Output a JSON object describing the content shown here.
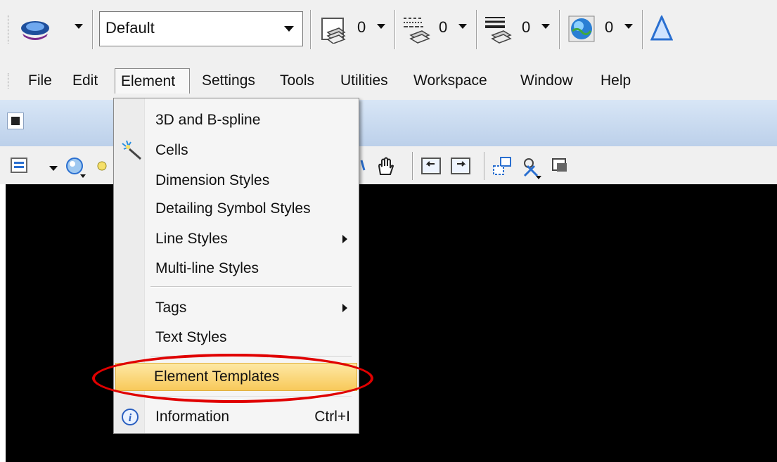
{
  "toolbar": {
    "style_combo_value": "Default",
    "level_count": "0",
    "linestyle_count": "0",
    "weight_count": "0",
    "color_count": "0",
    "icons": [
      "element-attributes-icon",
      "level-display-icon",
      "line-style-icon",
      "line-weight-icon",
      "color-globe-icon",
      "triangle-icon"
    ]
  },
  "menubar": {
    "items": [
      {
        "label": "File",
        "mnemonic": "F"
      },
      {
        "label": "Edit",
        "mnemonic": "E"
      },
      {
        "label": "Element",
        "mnemonic": "l"
      },
      {
        "label": "Settings",
        "mnemonic": "S"
      },
      {
        "label": "Tools",
        "mnemonic": "T"
      },
      {
        "label": "Utilities",
        "mnemonic": "U"
      },
      {
        "label": "Workspace",
        "mnemonic": "k"
      },
      {
        "label": "Window",
        "mnemonic": "W"
      },
      {
        "label": "Help",
        "mnemonic": "H"
      }
    ],
    "active": "Element"
  },
  "element_menu": {
    "items": [
      {
        "label": "3D and B-spline",
        "mnemonic": "B"
      },
      {
        "label": "Cells",
        "mnemonic": "C",
        "icon": "cells-wand-icon"
      },
      {
        "label": "Dimension Styles",
        "mnemonic": "D"
      },
      {
        "label": "Detailing Symbol Styles",
        "mnemonic": "t"
      },
      {
        "label": "Line Styles",
        "mnemonic": "L",
        "submenu": true
      },
      {
        "label": "Multi-line Styles",
        "mnemonic": "M"
      },
      {
        "label": "Tags",
        "mnemonic": "T",
        "submenu": true
      },
      {
        "label": "Text Styles",
        "mnemonic": "x"
      },
      {
        "label": "Element Templates",
        "mnemonic": "p",
        "highlighted": true
      },
      {
        "label": "Information",
        "mnemonic": "I",
        "shortcut": "Ctrl+I",
        "icon": "info-icon"
      }
    ]
  },
  "colors": {
    "highlight": "#f8c95a",
    "annotation_oval": "#e00000",
    "canvas": "#000000",
    "title_band": "#c8d9ef"
  }
}
